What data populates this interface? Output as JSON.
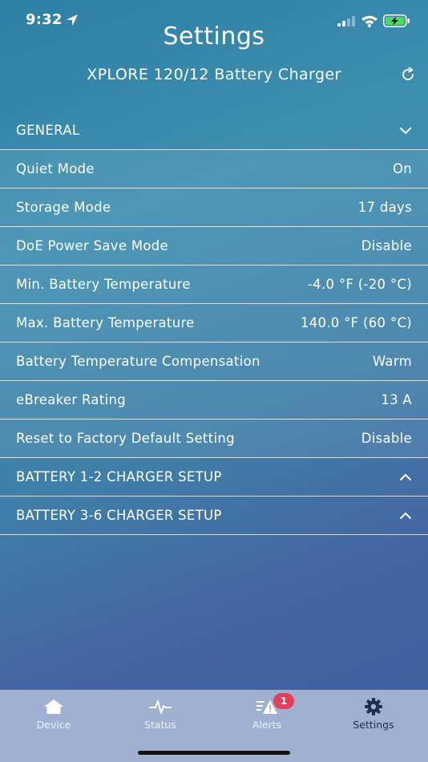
{
  "status": {
    "time": "9:32"
  },
  "header": {
    "title": "Settings",
    "device_name": "XPLORE 120/12 Battery Charger"
  },
  "sections": {
    "general": {
      "label": "GENERAL",
      "expanded": true
    },
    "settings": [
      {
        "label": "Quiet Mode",
        "value": "On"
      },
      {
        "label": "Storage Mode",
        "value": "17 days"
      },
      {
        "label": "DoE Power Save Mode",
        "value": "Disable"
      },
      {
        "label": "Min. Battery Temperature",
        "value": "-4.0 °F (-20 °C)"
      },
      {
        "label": "Max. Battery Temperature",
        "value": "140.0 °F (60 °C)"
      },
      {
        "label": "Battery Temperature Compensation",
        "value": "Warm"
      },
      {
        "label": "eBreaker Rating",
        "value": "13 A"
      },
      {
        "label": "Reset to Factory Default Setting",
        "value": "Disable"
      }
    ],
    "battery_1_2": {
      "label": "BATTERY 1-2 CHARGER SETUP",
      "expanded": false
    },
    "battery_3_6": {
      "label": "BATTERY 3-6 CHARGER SETUP",
      "expanded": false
    }
  },
  "tabs": [
    {
      "label": "Device",
      "icon": "home-icon"
    },
    {
      "label": "Status",
      "icon": "pulse-icon"
    },
    {
      "label": "Alerts",
      "icon": "alerts-icon",
      "badge": "1"
    },
    {
      "label": "Settings",
      "icon": "gear-icon",
      "active": true
    }
  ],
  "colors": {
    "tab_bar": "#9fb0d0",
    "badge": "#e0405a",
    "battery_fill": "#4cd964"
  }
}
